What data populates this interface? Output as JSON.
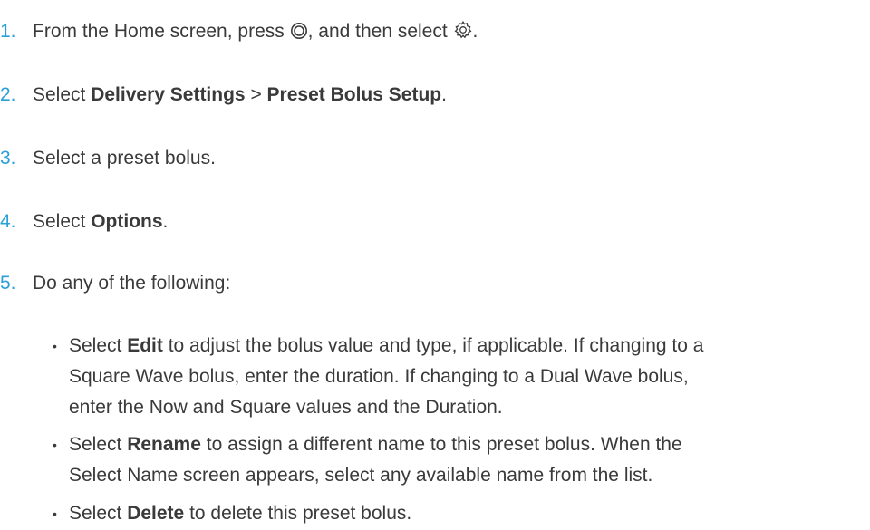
{
  "steps": [
    {
      "num": "1.",
      "before_button_icon": "From the Home screen, press ",
      "button_icon": "select-button-icon",
      "between_icons": ", and then select ",
      "settings_icon": "gear-icon",
      "after": "."
    },
    {
      "num": "2.",
      "prefix": "Select ",
      "bold1": "Delivery Settings",
      "sep": " > ",
      "bold2": "Preset Bolus Setup",
      "suffix": "."
    },
    {
      "num": "3.",
      "text": "Select a preset bolus."
    },
    {
      "num": "4.",
      "prefix": "Select ",
      "bold": "Options",
      "suffix": "."
    },
    {
      "num": "5.",
      "text": "Do any of the following:"
    }
  ],
  "bullets": [
    {
      "prefix": "Select ",
      "bold": "Edit",
      "line1_rest": " to adjust the bolus value and type, if applicable. If changing to a",
      "line2": "Square Wave bolus, enter the duration. If changing to a Dual Wave bolus,",
      "line3": "enter the Now and Square values and the Duration."
    },
    {
      "prefix": "Select ",
      "bold": "Rename",
      "line1_rest": " to assign a different name to this preset bolus. When the",
      "line2": "Select Name screen appears, select any available name from the list."
    },
    {
      "prefix": "Select ",
      "bold": "Delete",
      "line1_rest": " to delete this preset bolus."
    }
  ],
  "bullet_symbol": "•",
  "colors": {
    "step_number": "#2aa0d8",
    "body_text": "#3a3a3a"
  }
}
